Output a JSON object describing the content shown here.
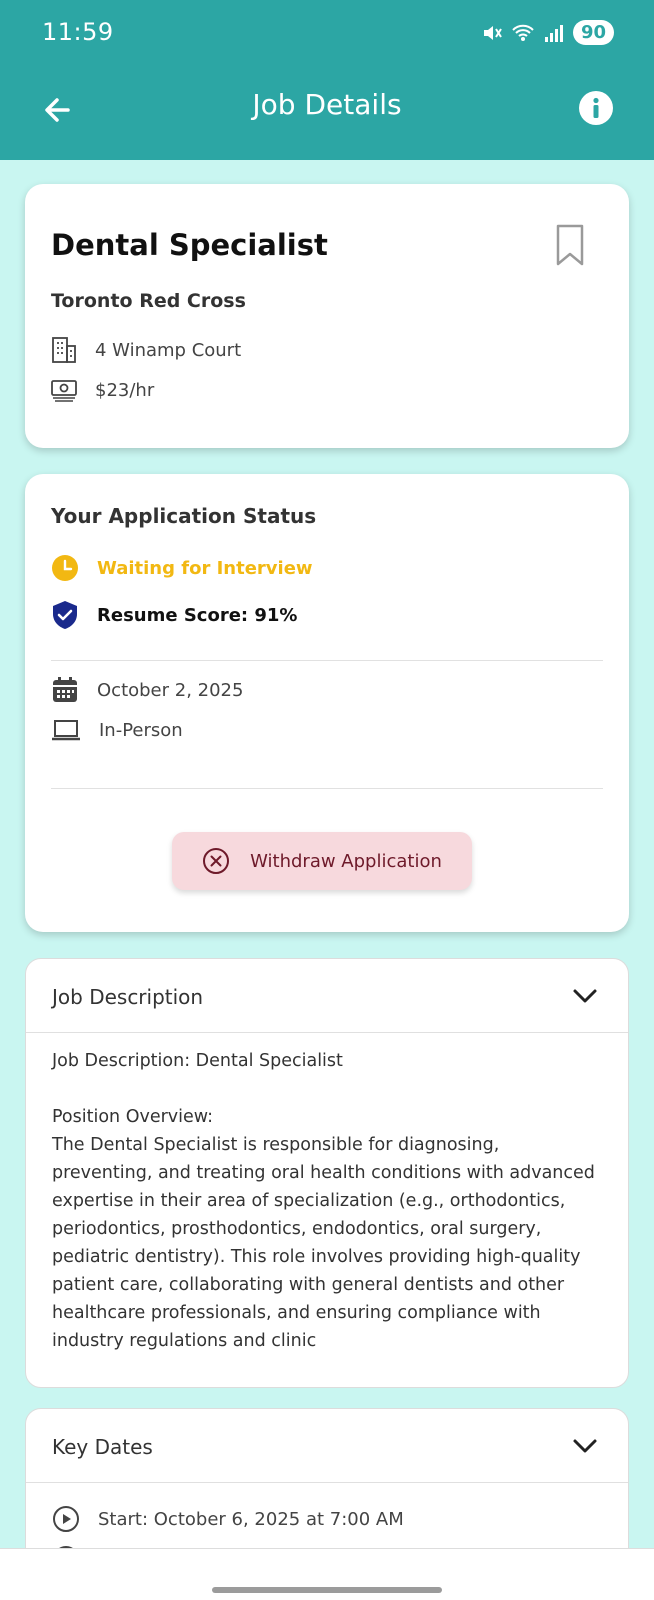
{
  "status_bar": {
    "time": "11:59",
    "battery": "90"
  },
  "app_bar": {
    "title": "Job Details"
  },
  "job": {
    "title": "Dental Specialist",
    "company": "Toronto Red Cross",
    "address": "4 Winamp Court",
    "pay": "$23/hr"
  },
  "application": {
    "section_title": "Your Application Status",
    "status": "Waiting for Interview",
    "resume_score": "Resume Score: 91%",
    "date": "October 2, 2025",
    "mode": "In-Person",
    "withdraw_label": "Withdraw Application"
  },
  "job_description": {
    "section_title": "Job Description",
    "text": "Job Description: Dental Specialist\n\nPosition Overview:\nThe Dental Specialist is responsible for diagnosing, preventing, and treating oral health conditions with advanced expertise in their area of specialization (e.g., orthodontics, periodontics, prosthodontics, endodontics, oral surgery, pediatric dentistry). This role involves providing high-quality patient care, collaborating with general dentists and other healthcare professionals, and ensuring compliance with industry regulations and clinic"
  },
  "key_dates": {
    "section_title": "Key Dates",
    "start": "Start: October 6, 2025 at 7:00 AM"
  },
  "colors": {
    "primary": "#2ca6a4",
    "background": "#c9f6f1",
    "status_yellow": "#f2b812",
    "shield_blue": "#1a2a8c",
    "withdraw_bg": "#f7d9dd",
    "withdraw_text": "#6e1a2a"
  },
  "icons": [
    "back-arrow-icon",
    "info-icon",
    "bookmark-icon",
    "building-icon",
    "money-icon",
    "clock-icon",
    "shield-check-icon",
    "calendar-icon",
    "laptop-icon",
    "close-circle-icon",
    "chevron-down-icon",
    "play-circle-icon"
  ]
}
